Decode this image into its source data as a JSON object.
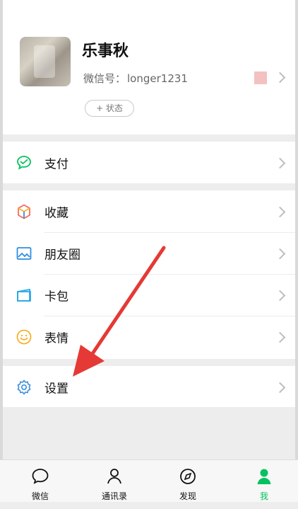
{
  "profile": {
    "nickname": "乐事秋",
    "wechat_id_label": "微信号：",
    "wechat_id_value": "longer1231",
    "status_button": "+ 状态"
  },
  "menu": {
    "pay": "支付",
    "favorites": "收藏",
    "moments": "朋友圈",
    "cards": "卡包",
    "stickers": "表情",
    "settings": "设置"
  },
  "tabbar": {
    "chats": "微信",
    "contacts": "通讯录",
    "discover": "发现",
    "me": "我"
  },
  "colors": {
    "active_tab": "#07c160",
    "pay_icon": "#07c160",
    "moments_icon": "#2f8ee0",
    "cards_icon": "#2aa7e6",
    "stickers_icon": "#f5b12b",
    "settings_icon": "#3b8fdc",
    "arrow": "#e53935"
  },
  "icons": {
    "pay": "pay-icon",
    "favorites": "favorites-icon",
    "moments": "moments-icon",
    "cards": "card-package-icon",
    "stickers": "stickers-icon",
    "settings": "gear-icon",
    "chats": "chat-bubble-icon",
    "contacts": "contacts-icon",
    "discover": "compass-icon",
    "me": "person-icon"
  }
}
